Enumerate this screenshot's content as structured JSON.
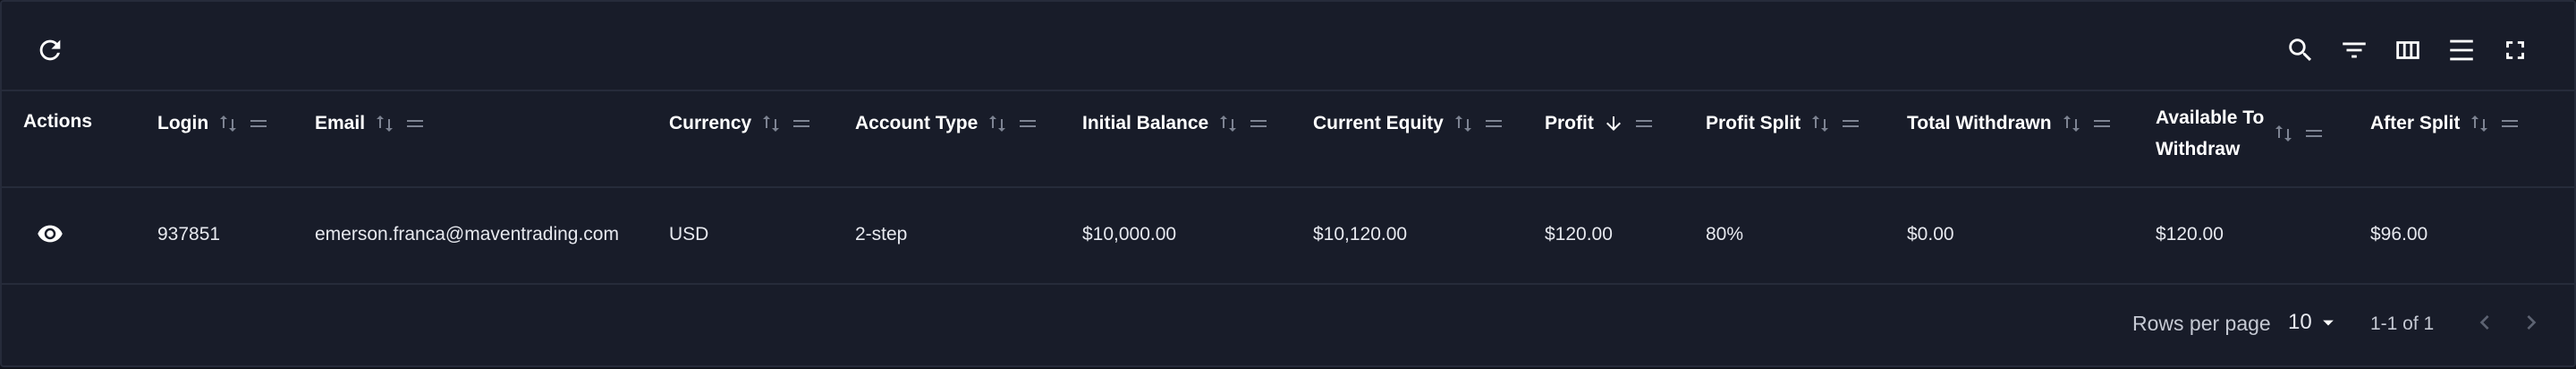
{
  "toolbar": {
    "refresh_icon": "refresh-icon",
    "right_icons": [
      "search-icon",
      "filter-icon",
      "columns-icon",
      "density-icon",
      "fullscreen-icon"
    ]
  },
  "table": {
    "columns": [
      {
        "key": "actions",
        "label": "Actions"
      },
      {
        "key": "login",
        "label": "Login"
      },
      {
        "key": "email",
        "label": "Email"
      },
      {
        "key": "currency",
        "label": "Currency"
      },
      {
        "key": "account_type",
        "label": "Account Type"
      },
      {
        "key": "initial_balance",
        "label": "Initial Balance"
      },
      {
        "key": "current_equity",
        "label": "Current Equity"
      },
      {
        "key": "profit",
        "label": "Profit",
        "sorted": "desc"
      },
      {
        "key": "profit_split",
        "label": "Profit Split"
      },
      {
        "key": "total_withdrawn",
        "label": "Total Withdrawn"
      },
      {
        "key": "available_to_withdraw",
        "label_line1": "Available To",
        "label_line2": "Withdraw"
      },
      {
        "key": "after_split",
        "label": "After Split"
      }
    ],
    "rows": [
      {
        "login": "937851",
        "email": "emerson.franca@maventrading.com",
        "currency": "USD",
        "account_type": "2-step",
        "initial_balance": "$10,000.00",
        "current_equity": "$10,120.00",
        "profit": "$120.00",
        "profit_split": "80%",
        "total_withdrawn": "$0.00",
        "available_to_withdraw": "$120.00",
        "after_split": "$96.00"
      }
    ]
  },
  "footer": {
    "rows_per_page_label": "Rows per page",
    "rows_per_page_value": "10",
    "range_text": "1-1 of 1"
  },
  "colors": {
    "background": "#181c29",
    "border": "#262b3a",
    "text": "#e6e8ee",
    "muted_icon": "#7d8392"
  }
}
